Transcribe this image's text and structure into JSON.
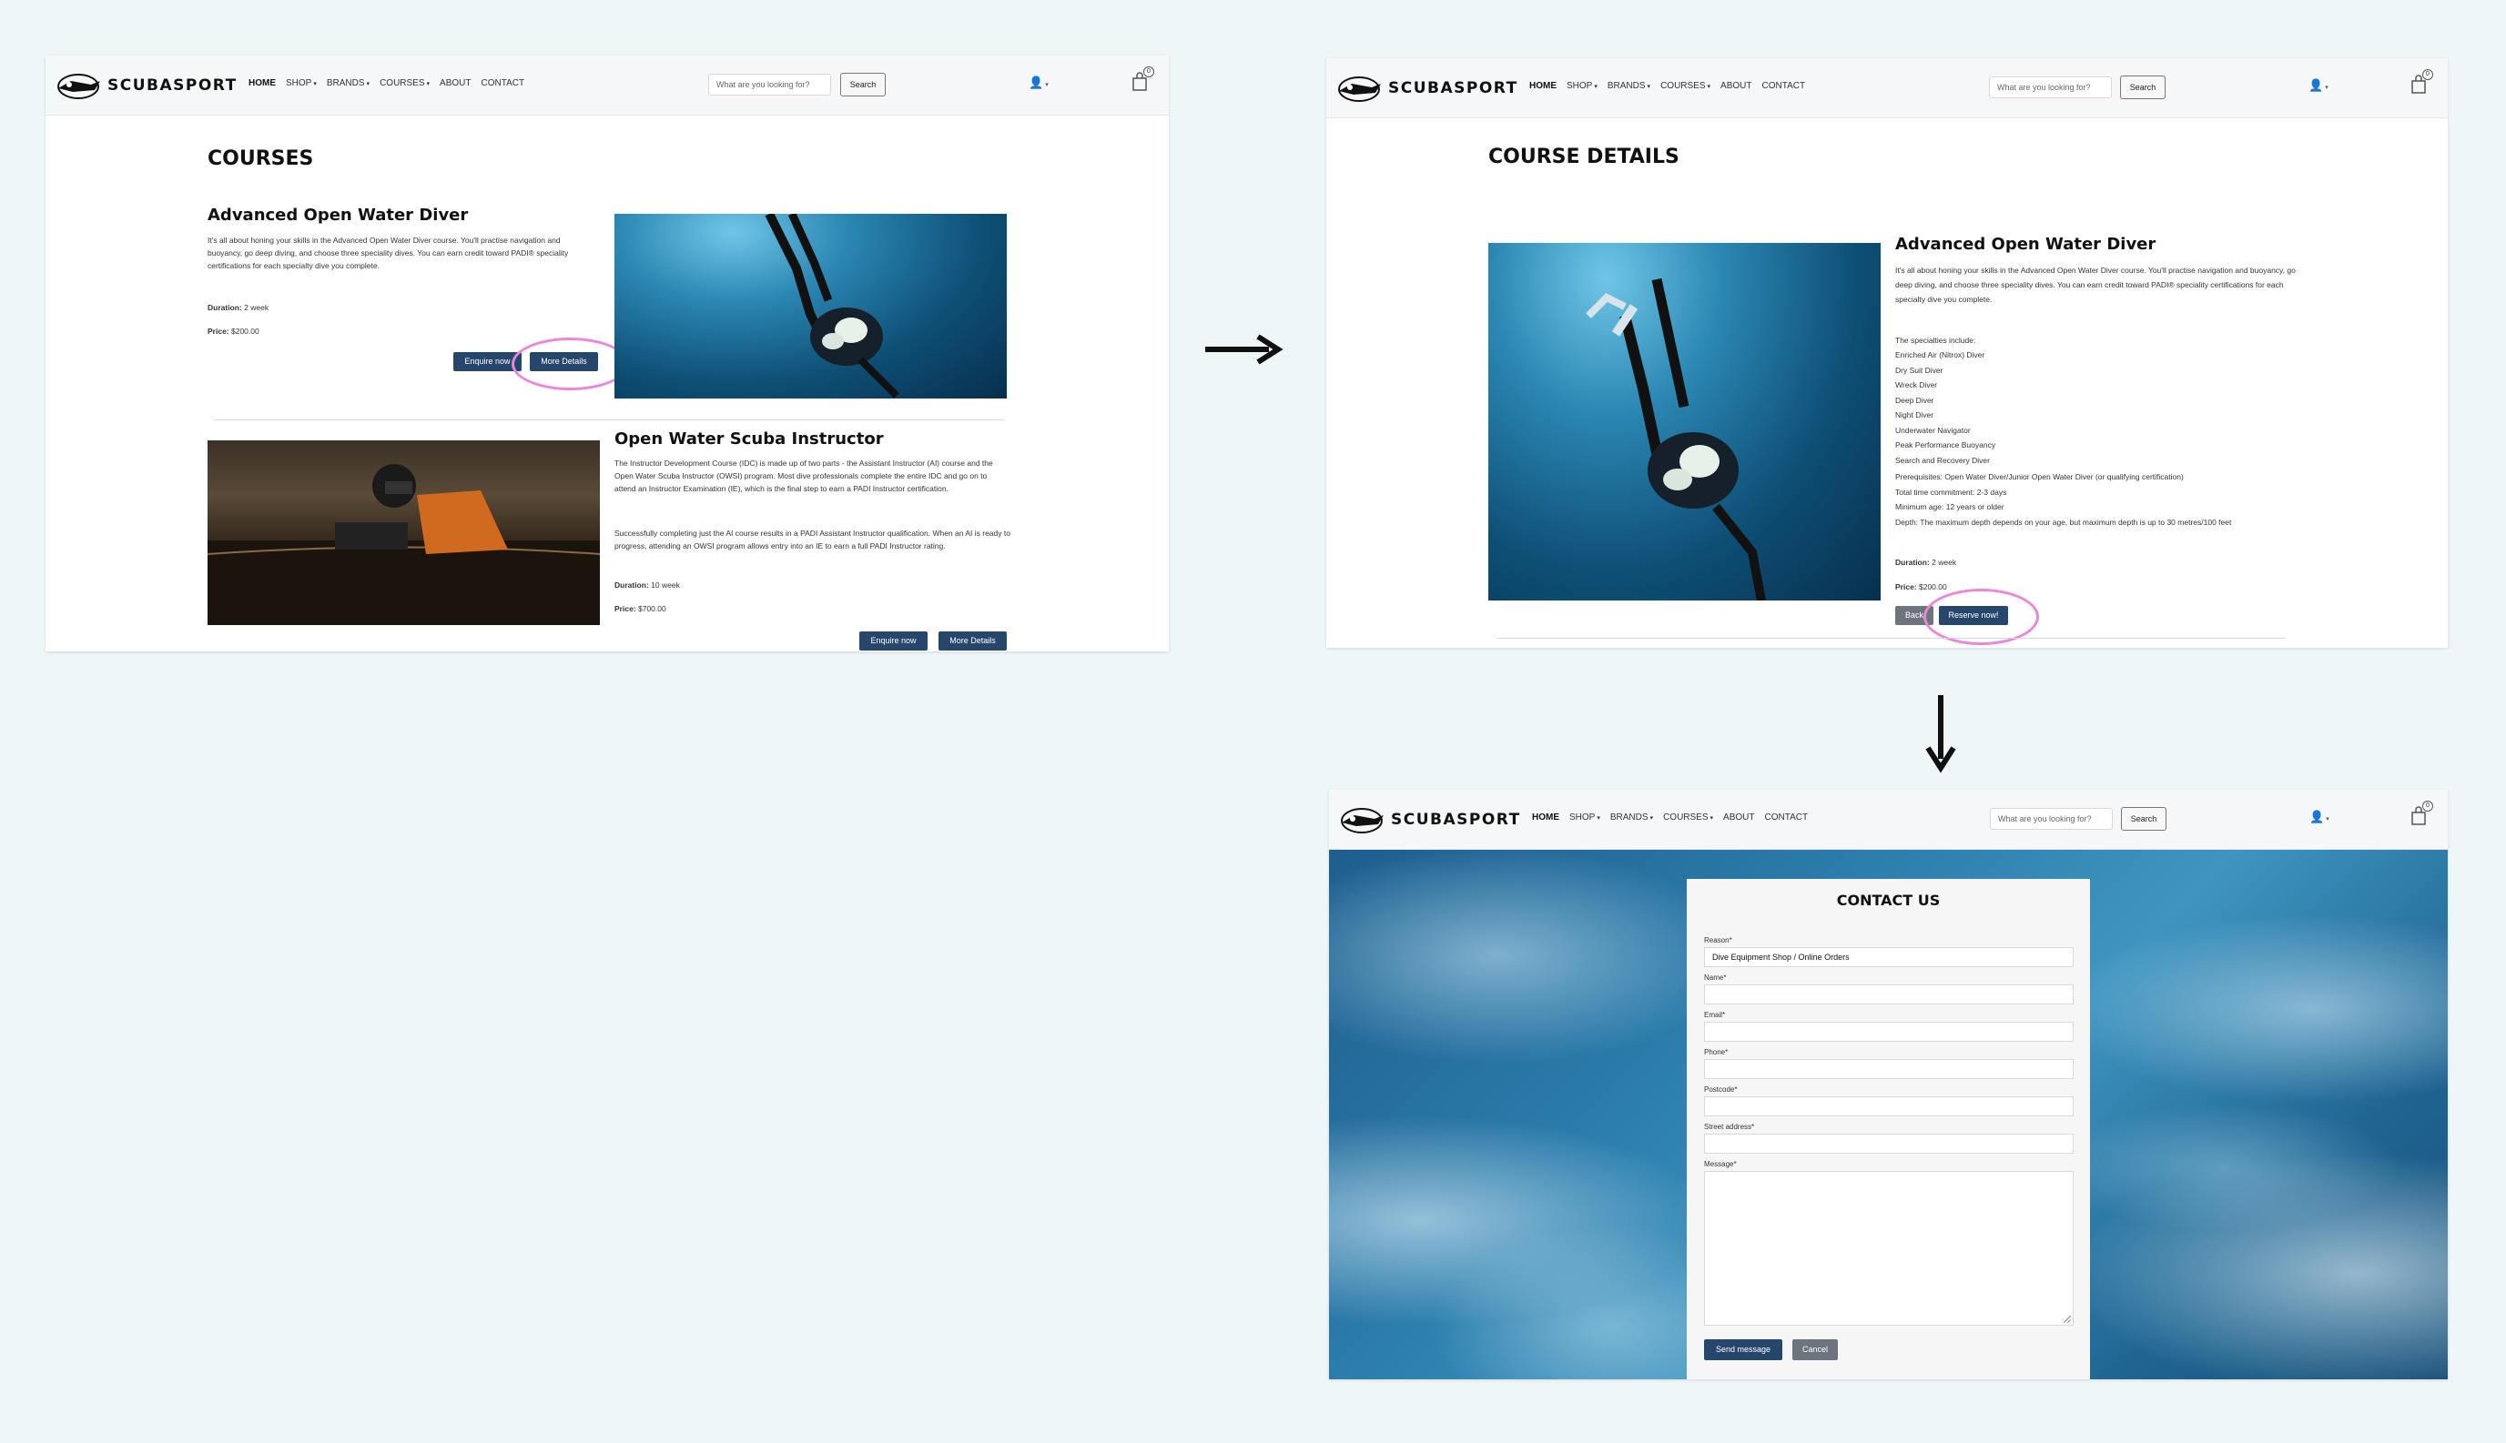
{
  "nav": {
    "brand": "SCUBASPORT",
    "links": [
      {
        "label": "HOME"
      },
      {
        "label": "SHOP"
      },
      {
        "label": "BRANDS"
      },
      {
        "label": "COURSES"
      },
      {
        "label": "ABOUT"
      },
      {
        "label": "CONTACT"
      }
    ],
    "search_placeholder": "What are you looking for?",
    "search_button": "Search",
    "cart_count": "0"
  },
  "courses_page": {
    "title": "COURSES",
    "course1": {
      "name": "Advanced Open Water Diver",
      "desc": "It's all about honing your skills in the Advanced Open Water Diver course. You'll practise navigation and buoyancy, go deep diving, and choose three speciality dives. You can earn credit toward PADI® speciality certifications for each specialty dive you complete.",
      "duration_label": "Duration:",
      "duration": "2 week",
      "price_label": "Price:",
      "price": "$200.00",
      "enquire": "Enquire now",
      "details": "More Details"
    },
    "course2": {
      "name": "Open Water Scuba Instructor",
      "desc1": "The Instructor Development Course (IDC) is made up of two parts - the Assistant Instructor (AI) course and the Open Water Scuba Instructor (OWSI) program. Most dive professionals complete the entire IDC and go on to attend an Instructor Examination (IE), which is the final step to earn a PADI Instructor certification.",
      "desc2": "Successfully completing just the AI course results in a PADI Assistant Instructor qualification. When an AI is ready to progress, attending an OWSI program allows entry into an IE to earn a full PADI Instructor rating.",
      "duration_label": "Duration:",
      "duration": "10 week",
      "price_label": "Price:",
      "price": "$700.00",
      "enquire": "Enquire now",
      "details": "More Details"
    }
  },
  "details_page": {
    "title": "COURSE DETAILS",
    "name": "Advanced Open Water Diver",
    "desc": "It's all about honing your skills in the Advanced Open Water Diver course. You'll practise navigation and buoyancy, go deep diving, and choose three speciality dives. You can earn credit toward PADI® speciality certifications for each specialty dive you complete.",
    "specialities_intro": "The specialties include:",
    "specialities": [
      "Enriched Air (Nitrox) Diver",
      "Dry Suit Diver",
      "Wreck Diver",
      "Deep Diver",
      "Night Diver",
      "Underwater Navigator",
      "Peak Performance Buoyancy",
      "Search and Recovery Diver"
    ],
    "prereq": "Prerequisites: Open Water Diver/Junior Open Water Diver (or qualifying certification)",
    "time": "Total time commitment: 2-3 days",
    "min_age": "Minimum age: 12 years or older",
    "depth": "Depth: The maximum depth depends on your age, but maximum depth is up to 30 metres/100 feet",
    "duration_label": "Duration:",
    "duration": "2 week",
    "price_label": "Price:",
    "price": "$200.00",
    "back": "Back",
    "reserve": "Reserve now!"
  },
  "contact_page": {
    "title": "CONTACT US",
    "reason_label": "Reason*",
    "reason_value": "Dive Equipment Shop / Online Orders",
    "name_label": "Name*",
    "email_label": "Email*",
    "phone_label": "Phone*",
    "postcode_label": "Postcode*",
    "street_label": "Street address*",
    "message_label": "Message*",
    "send": "Send message",
    "cancel": "Cancel"
  },
  "colors": {
    "button_dark": "#26466b",
    "button_grey": "#6c757d",
    "highlight": "#e987d9",
    "background": "#eef6f8"
  }
}
